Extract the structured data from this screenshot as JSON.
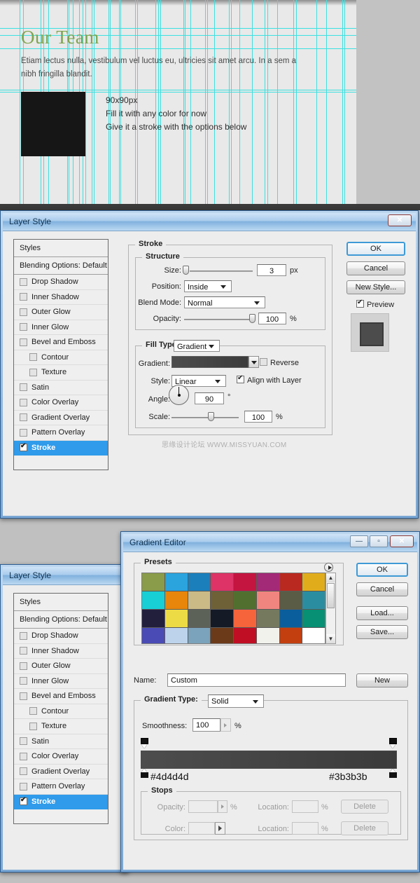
{
  "canvas": {
    "title": "Our Team",
    "paragraph": "Etiam lectus nulla, vestibulum vel luctus eu, ultricies sit amet arcu. In a sem a nibh fringilla blandit.",
    "notes": [
      "90x90px",
      "Fill it with any color for now",
      "Give it a stroke with the options below"
    ],
    "title_color": "#7fa44e",
    "guide_color": "#3ce0e0",
    "box_color": "#161616",
    "page_bg": "#e9e9e9",
    "guides_v": [
      28,
      33,
      58,
      62,
      69,
      96,
      98,
      104,
      113,
      118,
      122,
      131,
      134,
      155,
      157,
      170,
      172,
      193,
      196,
      222,
      226,
      229,
      262,
      264,
      272,
      293,
      296,
      306,
      327,
      330,
      342,
      360,
      378,
      382,
      396,
      419,
      423,
      452,
      466,
      489,
      492
    ],
    "guides_h": [
      40,
      50,
      69,
      128,
      131
    ]
  },
  "layer_style_top": {
    "window_title": "Layer Style",
    "close_label": "✕",
    "styles_header": "Styles",
    "blending_options": "Blending Options: Default",
    "effects": [
      {
        "label": "Drop Shadow",
        "checked": false,
        "sub": false,
        "selected": false
      },
      {
        "label": "Inner Shadow",
        "checked": false,
        "sub": false,
        "selected": false
      },
      {
        "label": "Outer Glow",
        "checked": false,
        "sub": false,
        "selected": false
      },
      {
        "label": "Inner Glow",
        "checked": false,
        "sub": false,
        "selected": false
      },
      {
        "label": "Bevel and Emboss",
        "checked": false,
        "sub": false,
        "selected": false
      },
      {
        "label": "Contour",
        "checked": false,
        "sub": true,
        "selected": false
      },
      {
        "label": "Texture",
        "checked": false,
        "sub": true,
        "selected": false
      },
      {
        "label": "Satin",
        "checked": false,
        "sub": false,
        "selected": false
      },
      {
        "label": "Color Overlay",
        "checked": false,
        "sub": false,
        "selected": false
      },
      {
        "label": "Gradient Overlay",
        "checked": false,
        "sub": false,
        "selected": false
      },
      {
        "label": "Pattern Overlay",
        "checked": false,
        "sub": false,
        "selected": false
      },
      {
        "label": "Stroke",
        "checked": true,
        "sub": false,
        "selected": true
      }
    ],
    "stroke_group": "Stroke",
    "structure_group": "Structure",
    "size_label": "Size:",
    "size_value": "3",
    "size_unit": "px",
    "position_label": "Position:",
    "position_value": "Inside",
    "blend_mode_label": "Blend Mode:",
    "blend_mode_value": "Normal",
    "opacity_label": "Opacity:",
    "opacity_value": "100",
    "opacity_unit": "%",
    "fill_type_label": "Fill Type:",
    "fill_type_value": "Gradient",
    "gradient_label": "Gradient:",
    "reverse_label": "Reverse",
    "reverse_checked": false,
    "style_label": "Style:",
    "style_value": "Linear",
    "align_label": "Align with Layer",
    "align_checked": true,
    "angle_label": "Angle:",
    "angle_value": "90",
    "angle_unit": "°",
    "scale_label": "Scale:",
    "scale_value": "100",
    "scale_unit": "%",
    "watermark": "思缘设计论坛  WWW.MISSYUAN.COM",
    "buttons": {
      "ok": "OK",
      "cancel": "Cancel",
      "new_style": "New Style..."
    },
    "preview_label": "Preview",
    "preview_checked": true,
    "gradient_css": "linear-gradient(to right,#4d4d4d,#3b3b3b)"
  },
  "layer_style_bottom": {
    "window_title": "Layer Style",
    "styles_header": "Styles",
    "blending_options": "Blending Options: Default",
    "effects": [
      {
        "label": "Drop Shadow",
        "checked": false,
        "sub": false,
        "selected": false
      },
      {
        "label": "Inner Shadow",
        "checked": false,
        "sub": false,
        "selected": false
      },
      {
        "label": "Outer Glow",
        "checked": false,
        "sub": false,
        "selected": false
      },
      {
        "label": "Inner Glow",
        "checked": false,
        "sub": false,
        "selected": false
      },
      {
        "label": "Bevel and Emboss",
        "checked": false,
        "sub": false,
        "selected": false
      },
      {
        "label": "Contour",
        "checked": false,
        "sub": true,
        "selected": false
      },
      {
        "label": "Texture",
        "checked": false,
        "sub": true,
        "selected": false
      },
      {
        "label": "Satin",
        "checked": false,
        "sub": false,
        "selected": false
      },
      {
        "label": "Color Overlay",
        "checked": false,
        "sub": false,
        "selected": false
      },
      {
        "label": "Gradient Overlay",
        "checked": false,
        "sub": false,
        "selected": false
      },
      {
        "label": "Pattern Overlay",
        "checked": false,
        "sub": false,
        "selected": false
      },
      {
        "label": "Stroke",
        "checked": true,
        "sub": false,
        "selected": true
      }
    ]
  },
  "gradient_editor": {
    "window_title": "Gradient Editor",
    "minimize_label": "—",
    "maximize_label": "▫",
    "close_label": "✕",
    "presets_group": "Presets",
    "preset_colors": [
      "#8a9b4a",
      "#2ba3dd",
      "#1a7fbb",
      "#dd3366",
      "#c41540",
      "#a32a77",
      "#b92920",
      "#e0ac1c",
      "#18cfd6",
      "#e8860b",
      "#cbba86",
      "#6e6037",
      "#51702f",
      "#f0857f",
      "#5a5c45",
      "#2a8ea0",
      "#221f3d",
      "#eddb46",
      "#5d6258",
      "#141a26",
      "#f5643b",
      "#757a5f",
      "#0a5e9c",
      "#079073",
      "#4a4bb5",
      "#bcd3eb",
      "#7ba3bb",
      "#6b3a18",
      "#c00f24",
      "#f2f2ec",
      "#c33f10",
      "#ffffff"
    ],
    "buttons": {
      "ok": "OK",
      "cancel": "Cancel",
      "load": "Load...",
      "save": "Save...",
      "new": "New",
      "delete1": "Delete",
      "delete2": "Delete"
    },
    "name_label": "Name:",
    "name_value": "Custom",
    "gradient_type_label": "Gradient Type:",
    "gradient_type_value": "Solid",
    "smoothness_label": "Smoothness:",
    "smoothness_value": "100",
    "smoothness_unit": "%",
    "gradient_css": "linear-gradient(to right,#4d4d4d,#3b3b3b)",
    "stop_left_hex": "#4d4d4d",
    "stop_right_hex": "#3b3b3b",
    "stops_group": "Stops",
    "opacity_label": "Opacity:",
    "opacity_value": "",
    "opacity_unit": "%",
    "location_label_1": "Location:",
    "location_value_1": "",
    "location_unit_1": "%",
    "color_label": "Color:",
    "location_label_2": "Location:",
    "location_value_2": "",
    "location_unit_2": "%"
  }
}
